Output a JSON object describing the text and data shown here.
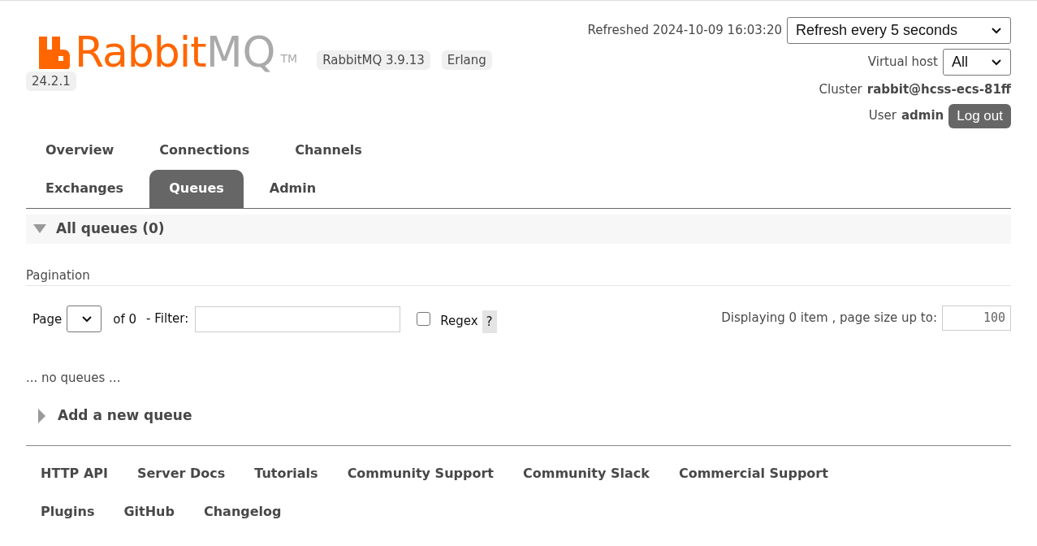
{
  "header": {
    "logo": {
      "brand": "Rabbit",
      "suffix": "MQ",
      "trademark": "TM"
    },
    "badges": [
      "RabbitMQ 3.9.13",
      "Erlang 24.2.1"
    ],
    "refreshed": "Refreshed 2024-10-09 16:03:20",
    "refresh_select": {
      "value": "Refresh every 5 seconds"
    },
    "virtual_host": {
      "label": "Virtual host",
      "value": "All"
    },
    "cluster": {
      "label": "Cluster",
      "value": "rabbit@hcss-ecs-81ff"
    },
    "user": {
      "label": "User",
      "value": "admin"
    },
    "logout_button": "Log out"
  },
  "tabs": [
    {
      "label": "Overview",
      "selected": false
    },
    {
      "label": "Connections",
      "selected": false
    },
    {
      "label": "Channels",
      "selected": false
    },
    {
      "label": "Exchanges",
      "selected": false
    },
    {
      "label": "Queues",
      "selected": true
    },
    {
      "label": "Admin",
      "selected": false
    }
  ],
  "sections": [
    {
      "title": "All queues (0)",
      "expanded": true
    }
  ],
  "pagination": {
    "heading": "Pagination",
    "page_label": "Page",
    "of_label": "of 0",
    "filter_label": "- Filter:",
    "regex": {
      "label": "Regex",
      "checked": false
    },
    "help": "?",
    "displaying": "Displaying 0 item , page size up to:",
    "page_size": "100"
  },
  "empty_message": "... no queues ...",
  "add_section": {
    "title": "Add a new queue",
    "expanded": false
  },
  "footer_links": [
    [
      "HTTP API",
      "Server Docs",
      "Tutorials",
      "Community Support",
      "Community Slack",
      "Commercial Support"
    ],
    [
      "Plugins",
      "GitHub",
      "Changelog"
    ]
  ]
}
